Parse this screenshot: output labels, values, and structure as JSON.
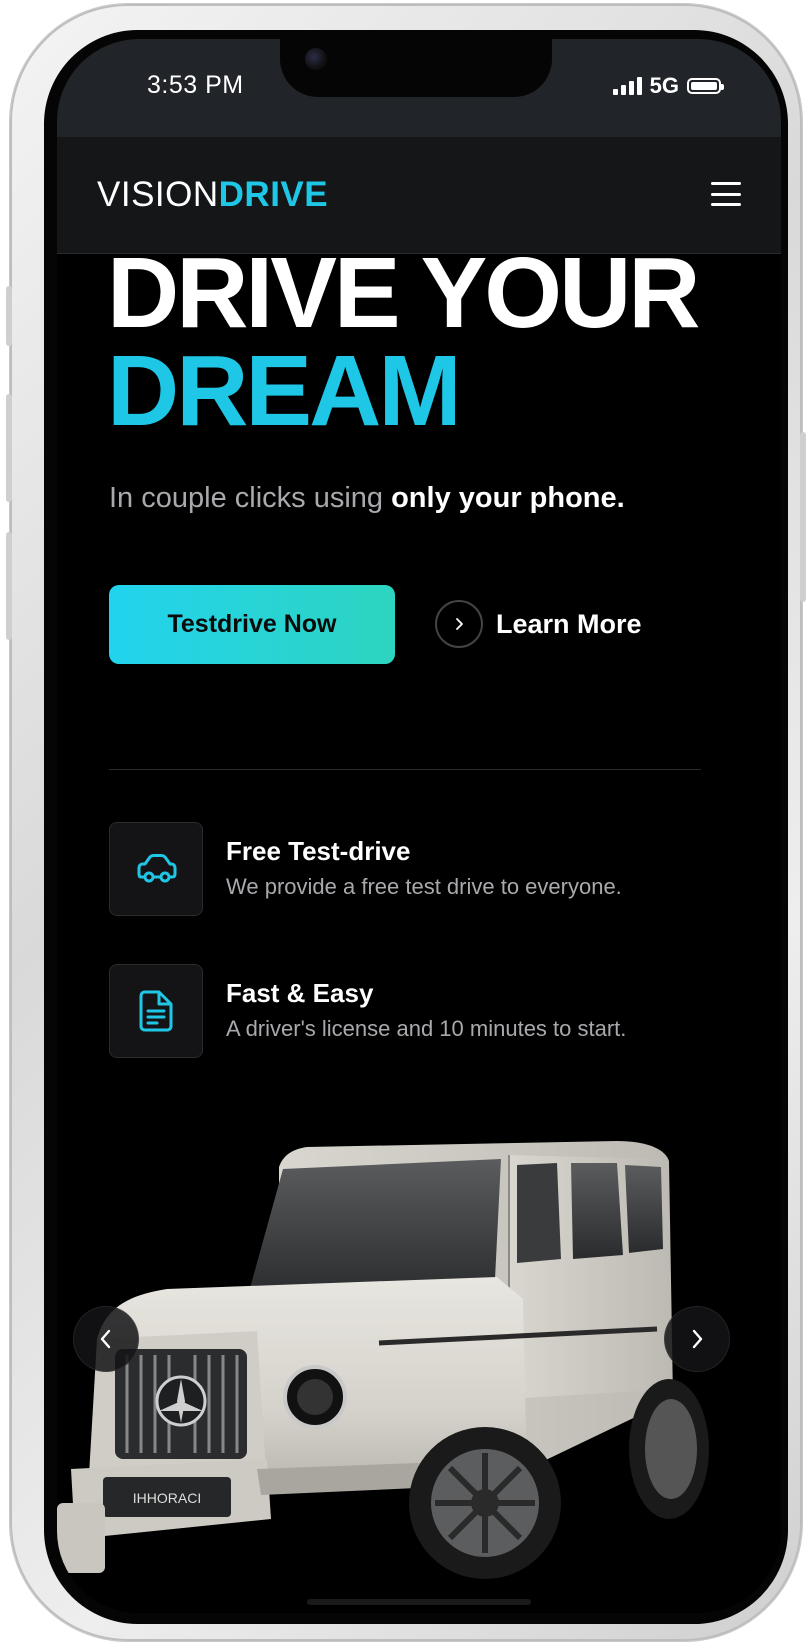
{
  "status_bar": {
    "time": "3:53 PM",
    "network": "5G"
  },
  "navbar": {
    "logo_part1": "VISION",
    "logo_part2": "DRIVE",
    "menu_icon": "hamburger-menu-icon"
  },
  "hero": {
    "title_line1": "DRIVE YOUR",
    "title_line2": "DREAM",
    "subtitle_plain": "In couple clicks using ",
    "subtitle_bold": "only your phone.",
    "primary_button": "Testdrive Now",
    "secondary_link": "Learn More"
  },
  "features": [
    {
      "icon": "car-icon",
      "title": "Free Test-drive",
      "description": "We provide a free test drive to everyone."
    },
    {
      "icon": "document-icon",
      "title": "Fast & Easy",
      "description": "A driver's license and 10 minutes to start."
    }
  ],
  "carousel": {
    "image": "white-suv-image",
    "plate_text": "IHHORACI",
    "prev_icon": "chevron-left-icon",
    "next_icon": "chevron-right-icon"
  },
  "colors": {
    "accent": "#1fc7e6",
    "accent_gradient_end": "#2dd4bf",
    "background": "#000000",
    "navbar": "#151617",
    "muted_text": "#a9a9ad"
  }
}
